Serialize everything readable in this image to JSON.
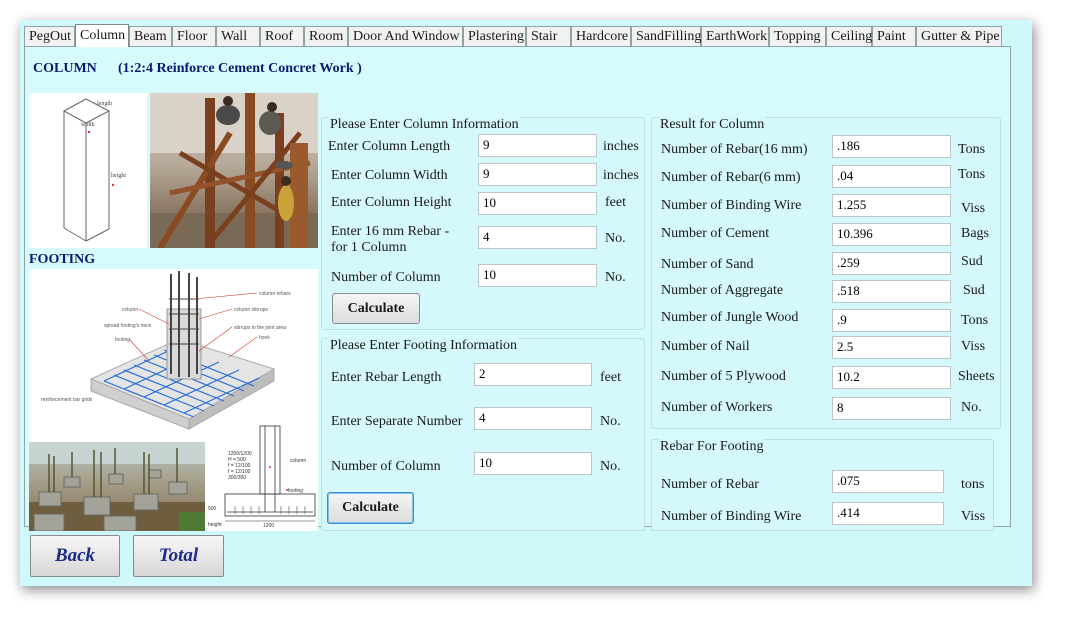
{
  "tabs": [
    "PegOut",
    "Column",
    "Beam",
    "Floor",
    "Wall",
    "Roof",
    "Room",
    "Door And Window",
    "Plastering",
    "Stair",
    "Hardcore",
    "SandFilling",
    "EarthWork",
    "Topping",
    "Ceiling",
    "Paint",
    "Gutter & Pipe"
  ],
  "active_tab": "Column",
  "header": {
    "title": "COLUMN",
    "subtitle": "(1:2:4 Reinforce Cement Concret Work )"
  },
  "footing_heading": "FOOTING",
  "column_diagram": {
    "length": "length",
    "width": "width",
    "height": "height"
  },
  "footing_diagram": {
    "labels": [
      "column rebars",
      "column",
      "column stirrups",
      "spread footing's neck",
      "footing",
      "stirrups in the joint area",
      "hook",
      "reinforcement bar grids"
    ]
  },
  "footing_section": {
    "labels": [
      "1200/1200",
      "H = 500",
      "f = 12/100",
      "f = 12/100",
      "300/300",
      "column",
      "footing",
      "500",
      "1200",
      "height"
    ]
  },
  "column_info": {
    "title": "Please Enter Column Information",
    "rows": [
      {
        "label": "Enter Column Length",
        "value": "9",
        "unit": "inches"
      },
      {
        "label": "Enter Column Width",
        "value": "9",
        "unit": "inches"
      },
      {
        "label": "Enter Column Height",
        "value": "10",
        "unit": "feet"
      },
      {
        "label": "Enter 16 mm Rebar -",
        "label2": "for 1 Column",
        "value": "4",
        "unit": "No."
      },
      {
        "label": "Number of Column",
        "value": "10",
        "unit": "No."
      }
    ],
    "button": "Calculate"
  },
  "footing_info": {
    "title": "Please Enter Footing Information",
    "rows": [
      {
        "label": "Enter Rebar Length",
        "value": "2",
        "unit": "feet"
      },
      {
        "label": "Enter Separate Number",
        "value": "4",
        "unit": "No."
      },
      {
        "label": "Number of Column",
        "value": "10",
        "unit": "No."
      }
    ],
    "button": "Calculate"
  },
  "result_column": {
    "title": "Result for Column",
    "rows": [
      {
        "label": "Number of Rebar(16 mm)",
        "value": ".186",
        "unit": "Tons"
      },
      {
        "label": "Number of Rebar(6 mm)",
        "value": ".04",
        "unit": "Tons"
      },
      {
        "label": "Number of Binding Wire",
        "value": "1.255",
        "unit": "Viss"
      },
      {
        "label": "Number of Cement",
        "value": "10.396",
        "unit": "Bags"
      },
      {
        "label": "Number of Sand",
        "value": ".259",
        "unit": "Sud"
      },
      {
        "label": "Number of Aggregate",
        "value": ".518",
        "unit": "Sud"
      },
      {
        "label": "Number of Jungle Wood",
        "value": ".9",
        "unit": "Tons"
      },
      {
        "label": "Number of Nail",
        "value": "2.5",
        "unit": "Viss"
      },
      {
        "label": "Number of 5 Plywood",
        "value": "10.2",
        "unit": "Sheets"
      },
      {
        "label": "Number of Workers",
        "value": "8",
        "unit": "No."
      }
    ]
  },
  "rebar_footing": {
    "title": "Rebar For Footing",
    "rows": [
      {
        "label": "Number of Rebar",
        "value": ".075",
        "unit": "tons"
      },
      {
        "label": "Number of Binding Wire",
        "value": ".414",
        "unit": "Viss"
      }
    ]
  },
  "nav": {
    "back": "Back",
    "total": "Total"
  },
  "colors": {
    "window_bg": "#cff8fb",
    "heading": "#0b1a6e",
    "nav_text": "#1c2b8a"
  }
}
